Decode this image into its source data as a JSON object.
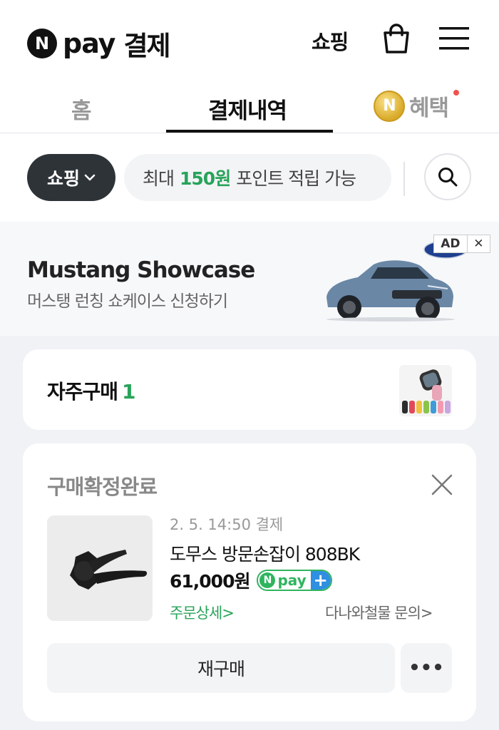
{
  "header": {
    "logo_n": "N",
    "logo_pay": "pay",
    "title": "결제",
    "shopping": "쇼핑",
    "icons": [
      "shopping-bag-icon",
      "hamburger-menu-icon"
    ]
  },
  "tabs": {
    "home": "홈",
    "payments": "결제내역",
    "benefits": "혜택",
    "coin_symbol": "N",
    "active": "결제내역"
  },
  "filter": {
    "category": "쇼핑",
    "promo_prefix": "최대",
    "promo_amount": "150원",
    "promo_suffix": "포인트 적립 가능"
  },
  "ad": {
    "title": "Mustang Showcase",
    "subtitle": "머스탱 런칭 쇼케이스 신청하기",
    "badge": "AD",
    "close": "✕",
    "brand": "Ford"
  },
  "frequent": {
    "label": "자주구매",
    "count": "1"
  },
  "order": {
    "status": "구매확정완료",
    "date": "2. 5. 14:50 결제",
    "product_name": "도무스 방문손잡이 808BK",
    "price": "61,000원",
    "npay_n": "N",
    "npay_text": "pay",
    "npay_plus": "+",
    "detail_link": "주문상세>",
    "seller_inquiry": "다나와철물 문의>",
    "rebuy": "재구매",
    "more": "•••"
  },
  "colors": {
    "accent_green": "#29a35a",
    "npay_green": "#2fb45e",
    "npay_blue": "#2f8fe0",
    "pill_dark": "#2e3338",
    "notification_red": "#f0524e"
  }
}
